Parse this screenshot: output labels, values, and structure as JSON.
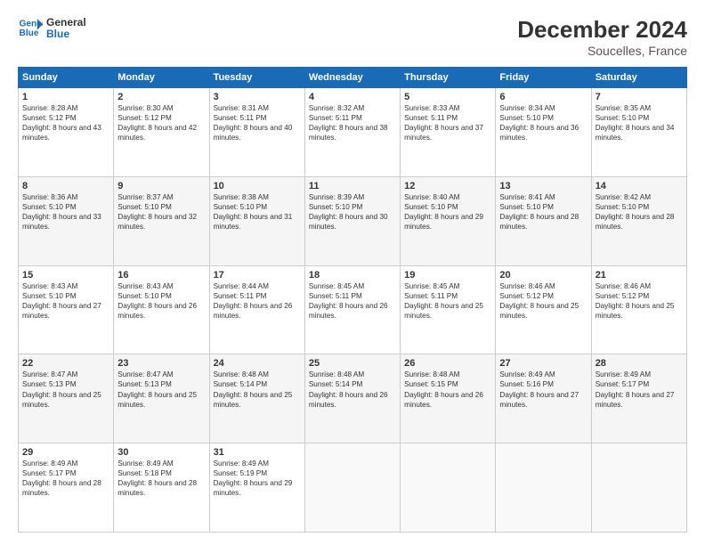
{
  "logo": {
    "line1": "General",
    "line2": "Blue"
  },
  "title": "December 2024",
  "subtitle": "Soucelles, France",
  "weekdays": [
    "Sunday",
    "Monday",
    "Tuesday",
    "Wednesday",
    "Thursday",
    "Friday",
    "Saturday"
  ],
  "weeks": [
    [
      {
        "day": "1",
        "sunrise": "Sunrise: 8:28 AM",
        "sunset": "Sunset: 5:12 PM",
        "daylight": "Daylight: 8 hours and 43 minutes."
      },
      {
        "day": "2",
        "sunrise": "Sunrise: 8:30 AM",
        "sunset": "Sunset: 5:12 PM",
        "daylight": "Daylight: 8 hours and 42 minutes."
      },
      {
        "day": "3",
        "sunrise": "Sunrise: 8:31 AM",
        "sunset": "Sunset: 5:11 PM",
        "daylight": "Daylight: 8 hours and 40 minutes."
      },
      {
        "day": "4",
        "sunrise": "Sunrise: 8:32 AM",
        "sunset": "Sunset: 5:11 PM",
        "daylight": "Daylight: 8 hours and 38 minutes."
      },
      {
        "day": "5",
        "sunrise": "Sunrise: 8:33 AM",
        "sunset": "Sunset: 5:11 PM",
        "daylight": "Daylight: 8 hours and 37 minutes."
      },
      {
        "day": "6",
        "sunrise": "Sunrise: 8:34 AM",
        "sunset": "Sunset: 5:10 PM",
        "daylight": "Daylight: 8 hours and 36 minutes."
      },
      {
        "day": "7",
        "sunrise": "Sunrise: 8:35 AM",
        "sunset": "Sunset: 5:10 PM",
        "daylight": "Daylight: 8 hours and 34 minutes."
      }
    ],
    [
      {
        "day": "8",
        "sunrise": "Sunrise: 8:36 AM",
        "sunset": "Sunset: 5:10 PM",
        "daylight": "Daylight: 8 hours and 33 minutes."
      },
      {
        "day": "9",
        "sunrise": "Sunrise: 8:37 AM",
        "sunset": "Sunset: 5:10 PM",
        "daylight": "Daylight: 8 hours and 32 minutes."
      },
      {
        "day": "10",
        "sunrise": "Sunrise: 8:38 AM",
        "sunset": "Sunset: 5:10 PM",
        "daylight": "Daylight: 8 hours and 31 minutes."
      },
      {
        "day": "11",
        "sunrise": "Sunrise: 8:39 AM",
        "sunset": "Sunset: 5:10 PM",
        "daylight": "Daylight: 8 hours and 30 minutes."
      },
      {
        "day": "12",
        "sunrise": "Sunrise: 8:40 AM",
        "sunset": "Sunset: 5:10 PM",
        "daylight": "Daylight: 8 hours and 29 minutes."
      },
      {
        "day": "13",
        "sunrise": "Sunrise: 8:41 AM",
        "sunset": "Sunset: 5:10 PM",
        "daylight": "Daylight: 8 hours and 28 minutes."
      },
      {
        "day": "14",
        "sunrise": "Sunrise: 8:42 AM",
        "sunset": "Sunset: 5:10 PM",
        "daylight": "Daylight: 8 hours and 28 minutes."
      }
    ],
    [
      {
        "day": "15",
        "sunrise": "Sunrise: 8:43 AM",
        "sunset": "Sunset: 5:10 PM",
        "daylight": "Daylight: 8 hours and 27 minutes."
      },
      {
        "day": "16",
        "sunrise": "Sunrise: 8:43 AM",
        "sunset": "Sunset: 5:10 PM",
        "daylight": "Daylight: 8 hours and 26 minutes."
      },
      {
        "day": "17",
        "sunrise": "Sunrise: 8:44 AM",
        "sunset": "Sunset: 5:11 PM",
        "daylight": "Daylight: 8 hours and 26 minutes."
      },
      {
        "day": "18",
        "sunrise": "Sunrise: 8:45 AM",
        "sunset": "Sunset: 5:11 PM",
        "daylight": "Daylight: 8 hours and 26 minutes."
      },
      {
        "day": "19",
        "sunrise": "Sunrise: 8:45 AM",
        "sunset": "Sunset: 5:11 PM",
        "daylight": "Daylight: 8 hours and 25 minutes."
      },
      {
        "day": "20",
        "sunrise": "Sunrise: 8:46 AM",
        "sunset": "Sunset: 5:12 PM",
        "daylight": "Daylight: 8 hours and 25 minutes."
      },
      {
        "day": "21",
        "sunrise": "Sunrise: 8:46 AM",
        "sunset": "Sunset: 5:12 PM",
        "daylight": "Daylight: 8 hours and 25 minutes."
      }
    ],
    [
      {
        "day": "22",
        "sunrise": "Sunrise: 8:47 AM",
        "sunset": "Sunset: 5:13 PM",
        "daylight": "Daylight: 8 hours and 25 minutes."
      },
      {
        "day": "23",
        "sunrise": "Sunrise: 8:47 AM",
        "sunset": "Sunset: 5:13 PM",
        "daylight": "Daylight: 8 hours and 25 minutes."
      },
      {
        "day": "24",
        "sunrise": "Sunrise: 8:48 AM",
        "sunset": "Sunset: 5:14 PM",
        "daylight": "Daylight: 8 hours and 25 minutes."
      },
      {
        "day": "25",
        "sunrise": "Sunrise: 8:48 AM",
        "sunset": "Sunset: 5:14 PM",
        "daylight": "Daylight: 8 hours and 26 minutes."
      },
      {
        "day": "26",
        "sunrise": "Sunrise: 8:48 AM",
        "sunset": "Sunset: 5:15 PM",
        "daylight": "Daylight: 8 hours and 26 minutes."
      },
      {
        "day": "27",
        "sunrise": "Sunrise: 8:49 AM",
        "sunset": "Sunset: 5:16 PM",
        "daylight": "Daylight: 8 hours and 27 minutes."
      },
      {
        "day": "28",
        "sunrise": "Sunrise: 8:49 AM",
        "sunset": "Sunset: 5:17 PM",
        "daylight": "Daylight: 8 hours and 27 minutes."
      }
    ],
    [
      {
        "day": "29",
        "sunrise": "Sunrise: 8:49 AM",
        "sunset": "Sunset: 5:17 PM",
        "daylight": "Daylight: 8 hours and 28 minutes."
      },
      {
        "day": "30",
        "sunrise": "Sunrise: 8:49 AM",
        "sunset": "Sunset: 5:18 PM",
        "daylight": "Daylight: 8 hours and 28 minutes."
      },
      {
        "day": "31",
        "sunrise": "Sunrise: 8:49 AM",
        "sunset": "Sunset: 5:19 PM",
        "daylight": "Daylight: 8 hours and 29 minutes."
      },
      null,
      null,
      null,
      null
    ]
  ]
}
